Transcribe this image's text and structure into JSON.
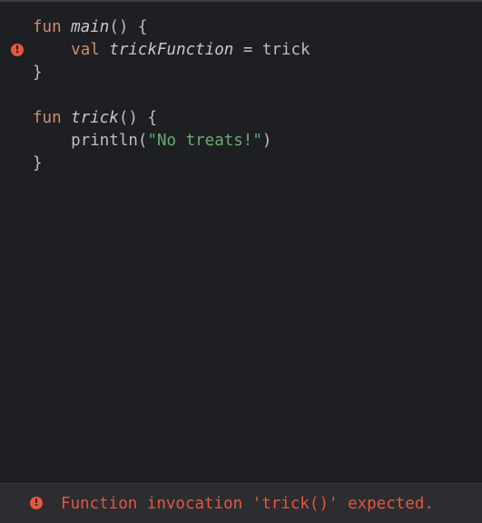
{
  "code": {
    "line1": {
      "kw": "fun",
      "name": "main",
      "rest": "() {"
    },
    "line2": {
      "indent": "    ",
      "kw": "val",
      "name": "trickFunction",
      "rest": " = trick"
    },
    "line3": {
      "text": "}"
    },
    "line5": {
      "kw": "fun",
      "name": "trick",
      "rest": "() {"
    },
    "line6": {
      "indent": "    ",
      "call": "println(",
      "str": "\"No treats!\"",
      "rest": ")"
    },
    "line7": {
      "text": "}"
    }
  },
  "gutter": {
    "error_marker_glyph": "!"
  },
  "status": {
    "icon_glyph": "!",
    "message": "Function invocation 'trick()' expected."
  },
  "colors": {
    "background": "#1e1f22",
    "keyword": "#cf8e6d",
    "string": "#6aab73",
    "text": "#bcbec4",
    "error": "#e5573f",
    "status_bar": "#2b2d30"
  },
  "icons": {
    "gutter_error": "error-circle-icon",
    "status_error": "error-circle-icon"
  }
}
